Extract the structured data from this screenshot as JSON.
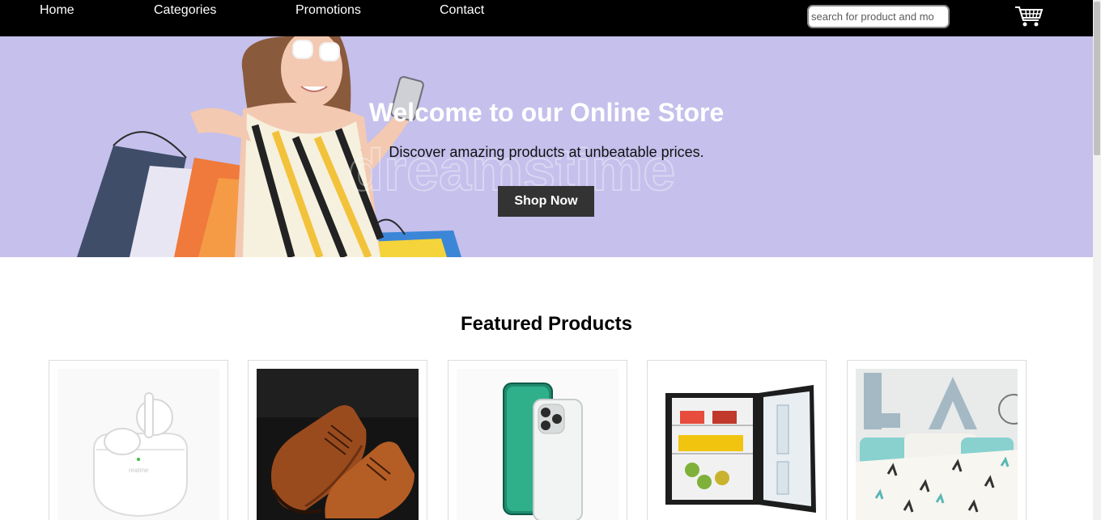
{
  "nav": {
    "links": [
      "Home",
      "Categories",
      "Promotions",
      "Contact"
    ],
    "search_placeholder": "search for product and mo",
    "cart_icon": "shopping-cart-icon"
  },
  "hero": {
    "title": "Welcome to our Online Store",
    "subtitle": "Discover amazing products at unbeatable prices.",
    "cta_label": "Shop Now",
    "background_color": "#c5c0ec"
  },
  "featured": {
    "title": "Featured Products",
    "products": [
      {
        "image": "wireless-earbuds"
      },
      {
        "image": "brown-leather-shoes"
      },
      {
        "image": "smartphone"
      },
      {
        "image": "mini-fridge"
      },
      {
        "image": "bedding-set"
      }
    ]
  },
  "colors": {
    "navbar": "#000000",
    "button": "#333333"
  }
}
